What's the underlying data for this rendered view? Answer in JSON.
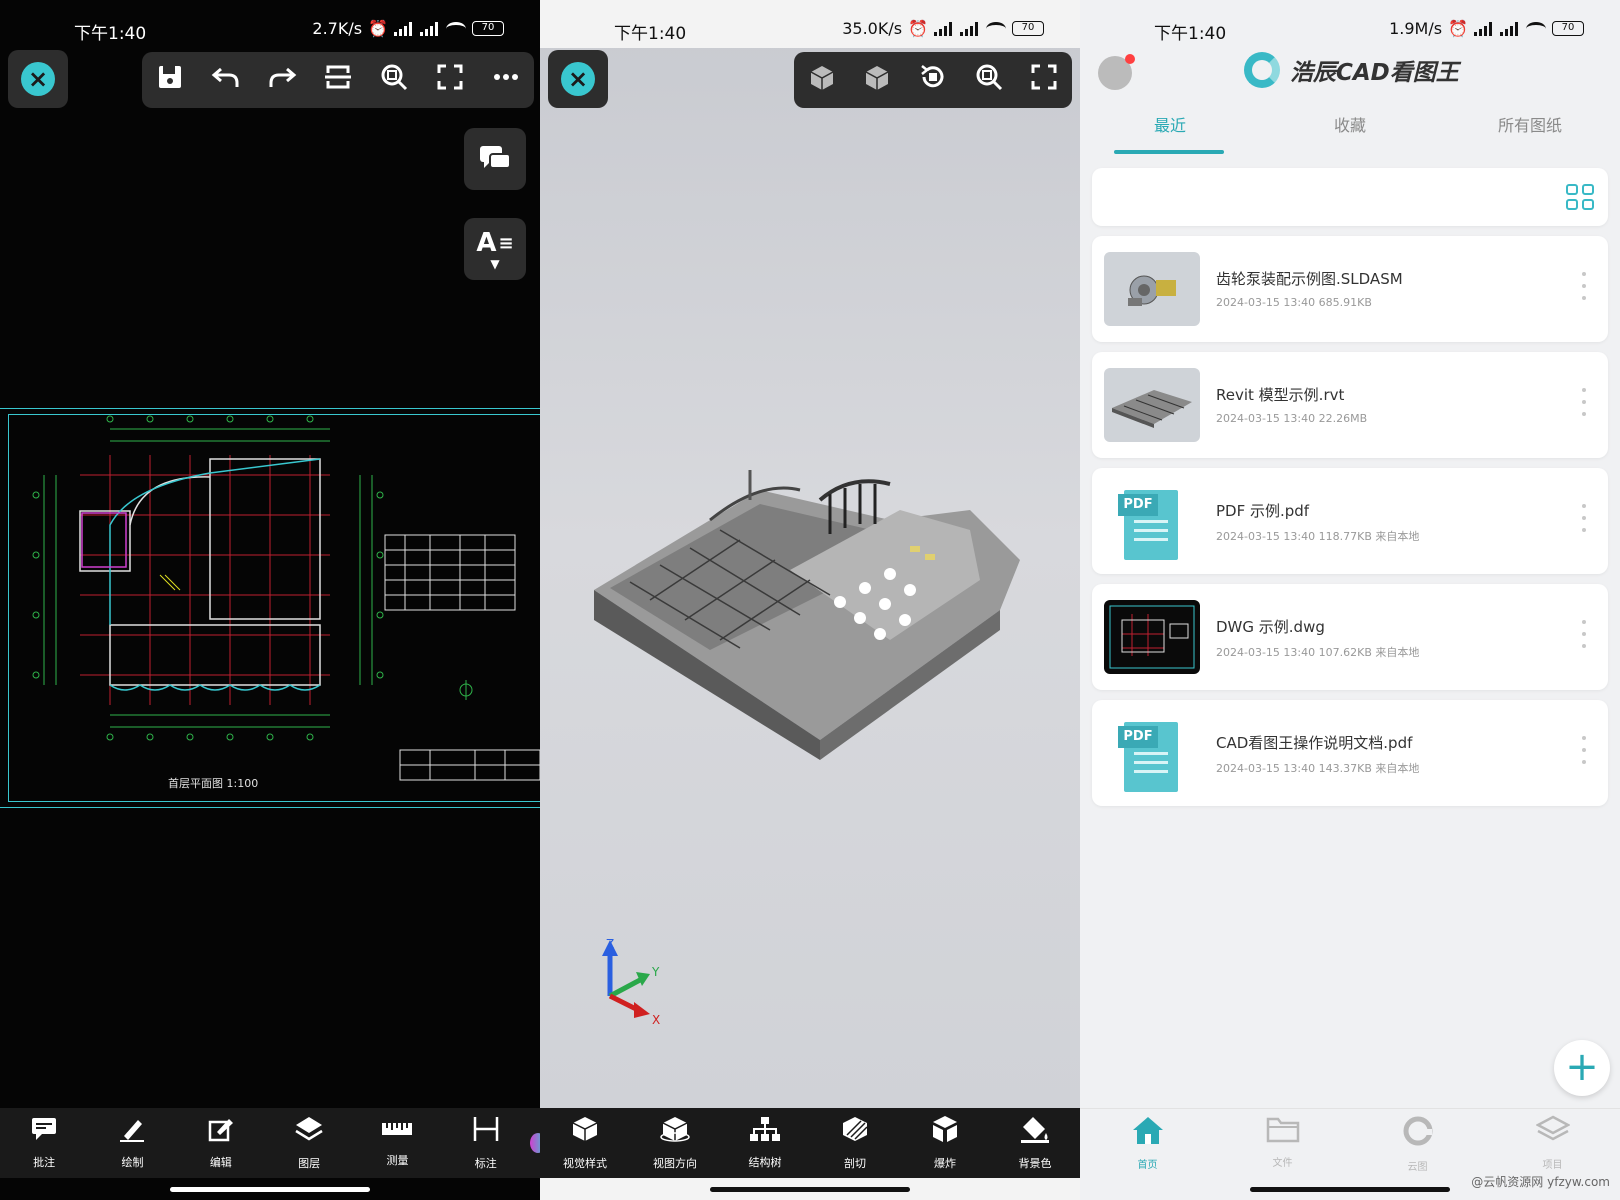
{
  "colors": {
    "accent": "#39c7cf",
    "teal": "#2aa9b4",
    "dark_panel": "#050505",
    "toolbar_bg": "#2d2d2d"
  },
  "panel1": {
    "status": {
      "time": "下午1:40",
      "speed": "2.7K/s",
      "battery": "70"
    },
    "toolbar_icons": [
      "save-icon",
      "undo-icon",
      "redo-icon",
      "section-icon",
      "zoom-icon",
      "fullscreen-icon",
      "more-icon"
    ],
    "side_text_label": "A",
    "bottom_tools": [
      {
        "label": "批注",
        "icon": "comment-icon"
      },
      {
        "label": "绘制",
        "icon": "pen-icon"
      },
      {
        "label": "编辑",
        "icon": "edit-icon"
      },
      {
        "label": "图层",
        "icon": "layers-icon"
      },
      {
        "label": "测量",
        "icon": "ruler-icon"
      },
      {
        "label": "标注",
        "icon": "dimension-icon"
      }
    ],
    "drawing_title": "首层平面图 1:100"
  },
  "panel2": {
    "status": {
      "time": "下午1:40",
      "speed": "35.0K/s",
      "battery": "70"
    },
    "axis_labels": {
      "z": "Z",
      "y": "Y",
      "x": "X"
    },
    "bottom_tools": [
      {
        "label": "视觉样式",
        "icon": "cube-icon"
      },
      {
        "label": "视图方向",
        "icon": "view-direction-icon"
      },
      {
        "label": "结构树",
        "icon": "tree-icon"
      },
      {
        "label": "剖切",
        "icon": "section-cut-icon"
      },
      {
        "label": "爆炸",
        "icon": "explode-icon"
      },
      {
        "label": "背景色",
        "icon": "paint-bucket-icon"
      }
    ]
  },
  "panel3": {
    "status": {
      "time": "下午1:40",
      "speed": "1.9M/s",
      "battery": "70"
    },
    "app_title": "浩辰CAD看图王",
    "tabs": [
      "最近",
      "收藏",
      "所有图纸"
    ],
    "files": [
      {
        "name": "齿轮泵装配示例图.SLDASM",
        "meta": "2024-03-15 13:40  685.91KB",
        "thumb": "sldasm"
      },
      {
        "name": "Revit 模型示例.rvt",
        "meta": "2024-03-15 13:40  22.26MB",
        "thumb": "rvt"
      },
      {
        "name": "PDF 示例.pdf",
        "meta": "2024-03-15 13:40  118.77KB  来自本地",
        "thumb": "pdf"
      },
      {
        "name": "DWG 示例.dwg",
        "meta": "2024-03-15 13:40  107.62KB  来自本地",
        "thumb": "dwg"
      },
      {
        "name": "CAD看图王操作说明文档.pdf",
        "meta": "2024-03-15 13:40  143.37KB  来自本地",
        "thumb": "pdf"
      }
    ],
    "pdf_tag": "PDF",
    "nav": [
      {
        "label": "首页",
        "icon": "home-icon"
      },
      {
        "label": "文件",
        "icon": "folder-icon"
      },
      {
        "label": "云图",
        "icon": "cloud-drawing-icon"
      },
      {
        "label": "项目",
        "icon": "project-layers-icon"
      }
    ],
    "fab": "+",
    "watermark": "@云帆资源网 yfzyw.com"
  }
}
